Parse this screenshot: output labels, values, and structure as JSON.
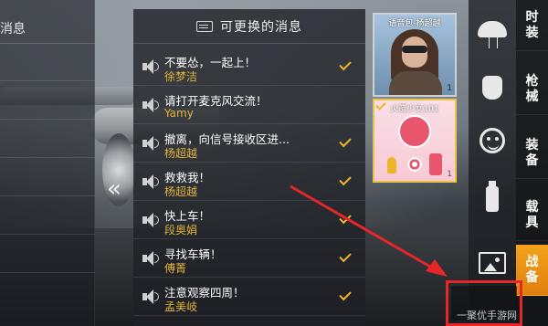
{
  "left_panel": {
    "header": "消息"
  },
  "header": {
    "title": "可更换的消息",
    "icon": "message-list-icon"
  },
  "messages": [
    {
      "text": "不要怂，一起上！",
      "author": "徐梦洁",
      "checked": true
    },
    {
      "text": "请打开麦克风交流！",
      "author": "Yamy",
      "checked": false
    },
    {
      "text": "撤离，向信号接收区进...",
      "author": "杨超越",
      "checked": true
    },
    {
      "text": "救救我！",
      "author": "杨超越",
      "checked": true
    },
    {
      "text": "快上车！",
      "author": "段奥娟",
      "checked": true
    },
    {
      "text": "寻找车辆！",
      "author": "傅菁",
      "checked": true
    },
    {
      "text": "注意观察四周！",
      "author": "孟美岐",
      "checked": true
    }
  ],
  "cards": [
    {
      "label": "语音包-杨超越",
      "count": "1",
      "selected": false
    },
    {
      "label": "火箭少女101",
      "count": "1",
      "selected": true
    }
  ],
  "icon_column": [
    "parachute-icon",
    "emote-hand-icon",
    "emoji-face-icon",
    "spray-icon",
    "image-icon"
  ],
  "tabs": [
    {
      "label": "时装",
      "active": false
    },
    {
      "label": "枪械",
      "active": false
    },
    {
      "label": "装备",
      "active": false
    },
    {
      "label": "载具",
      "active": false
    },
    {
      "label": "战备",
      "active": true
    }
  ],
  "chevron_glyph": "«",
  "watermark": "一聚优手游网",
  "colors": {
    "accent": "#f0b429",
    "author": "#e2b43b",
    "highlight": "#e8262a",
    "tab_active": "#f3a31a"
  }
}
